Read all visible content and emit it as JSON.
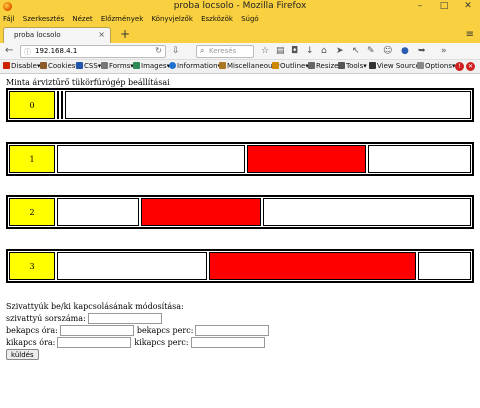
{
  "window": {
    "title": "proba locsolo - Mozilla Firefox",
    "minimize": "–",
    "maximize": "□",
    "close": "✕"
  },
  "menu": [
    "Fájl",
    "Szerkesztés",
    "Nézet",
    "Előzmények",
    "Könyvjelzők",
    "Eszközök",
    "Súgó"
  ],
  "tab": {
    "label": "proba locsolo",
    "close": "×",
    "new_tab": "+"
  },
  "nav": {
    "back": "←",
    "info_icon": "ⓘ",
    "url": "192.168.4.1",
    "reload": "↻",
    "search_placeholder": "Keresés",
    "search_icon": "⌕",
    "hamburger": "≡",
    "overflow": "»"
  },
  "toolbar_icons": [
    "download-icon",
    "bookmark-star-icon",
    "library-icon",
    "pocket-icon",
    "home-icon",
    "arrow-icon",
    "cursor-icon",
    "note-icon",
    "chat-icon",
    "circle-icon",
    "send-icon",
    "sync-icon"
  ],
  "webdev": {
    "items": [
      {
        "label": "Disable▾",
        "color": "#cc2200"
      },
      {
        "label": "Cookies▾",
        "color": "#8b5a2b"
      },
      {
        "label": "CSS▾",
        "color": "#2255aa"
      },
      {
        "label": "Forms▾",
        "color": "#777777"
      },
      {
        "label": "Images▾",
        "color": "#2e8b57"
      },
      {
        "label": "Information▾",
        "color": "#1e6fd0"
      },
      {
        "label": "Miscellaneous▾",
        "color": "#aa7722"
      },
      {
        "label": "Outline▾",
        "color": "#cc8800"
      },
      {
        "label": "Resize▾",
        "color": "#666666"
      },
      {
        "label": "Tools▾",
        "color": "#555555"
      },
      {
        "label": "View Source▾",
        "color": "#333333"
      },
      {
        "label": "Options▾",
        "color": "#888888"
      }
    ],
    "end_icons": [
      "error-icon",
      "close-icon",
      "stop-icon"
    ]
  },
  "page": {
    "heading": "Minta árviztűrő tükörfúrógép beállításai",
    "pumps": [
      {
        "id": "0",
        "segments": [
          {
            "state": "on",
            "fraction": 0.004
          },
          {
            "state": "on",
            "fraction": 0.006
          },
          {
            "state": "off",
            "fraction": 0.99
          }
        ]
      },
      {
        "id": "1",
        "segments": [
          {
            "state": "off",
            "fraction": 0.464
          },
          {
            "state": "on",
            "fraction": 0.292
          },
          {
            "state": "off",
            "fraction": 0.244
          }
        ]
      },
      {
        "id": "2",
        "segments": [
          {
            "state": "off",
            "fraction": 0.203
          },
          {
            "state": "on",
            "fraction": 0.295
          },
          {
            "state": "off",
            "fraction": 0.502
          }
        ]
      },
      {
        "id": "3",
        "segments": [
          {
            "state": "off",
            "fraction": 0.369
          },
          {
            "state": "on",
            "fraction": 0.511
          },
          {
            "state": "off",
            "fraction": 0.12
          }
        ]
      }
    ],
    "colors": {
      "on": "#ff0000",
      "off": "#ffffff",
      "id": "#ffff00"
    }
  },
  "form": {
    "title": "Szivattyúk be/ki kapcsolásának módosítása:",
    "pump_number_label": "szivattyú sorszáma:",
    "on_hour_label": "bekapcs óra:",
    "on_minute_label": "bekapcs perc:",
    "off_hour_label": "kikapcs óra:",
    "off_minute_label": "kikapcs perc:",
    "pump_number_value": "",
    "on_hour_value": "",
    "on_minute_value": "",
    "off_hour_value": "",
    "off_minute_value": "",
    "submit_label": "küldés"
  }
}
